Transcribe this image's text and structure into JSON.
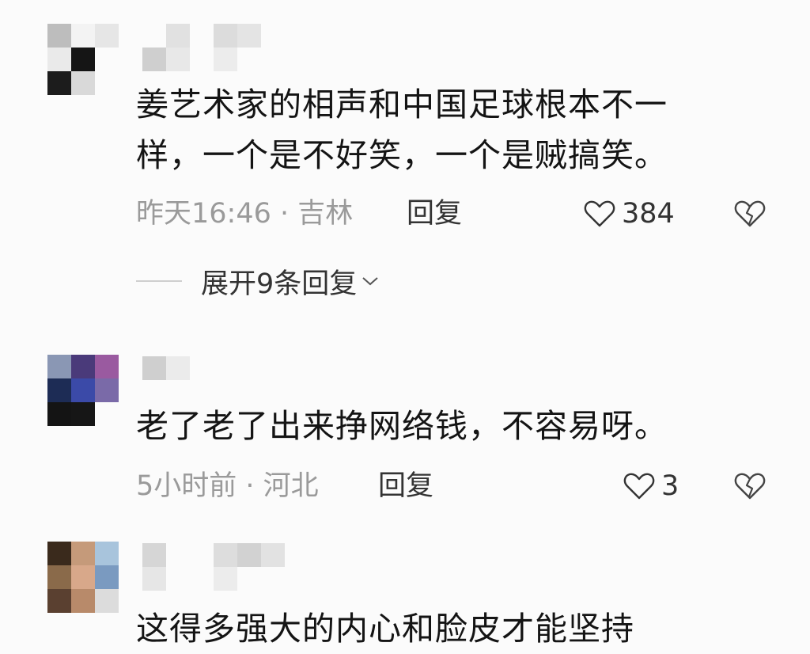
{
  "comments": [
    {
      "text_line1": "姜艺术家的相声和中国足球根本不一",
      "text_line2": "样，一个是不好笑，一个是贼搞笑。",
      "meta": "昨天16:46 · 吉林",
      "reply_label": "回复",
      "likes": "384",
      "expand_label": "展开9条回复"
    },
    {
      "text_line1": "老了老了出来挣网络钱，不容易呀。",
      "meta": "5小时前 · 河北",
      "reply_label": "回复",
      "likes": "3"
    },
    {
      "text_line1": "这得多强大的内心和脸皮才能坚持"
    }
  ],
  "icons": {
    "like": "heart-outline-icon",
    "dislike": "broken-heart-icon",
    "expand": "chevron-down-icon"
  },
  "colors": {
    "text": "#141414",
    "meta": "#9a9a9a",
    "action": "#333333",
    "background": "#fbfbfb"
  }
}
